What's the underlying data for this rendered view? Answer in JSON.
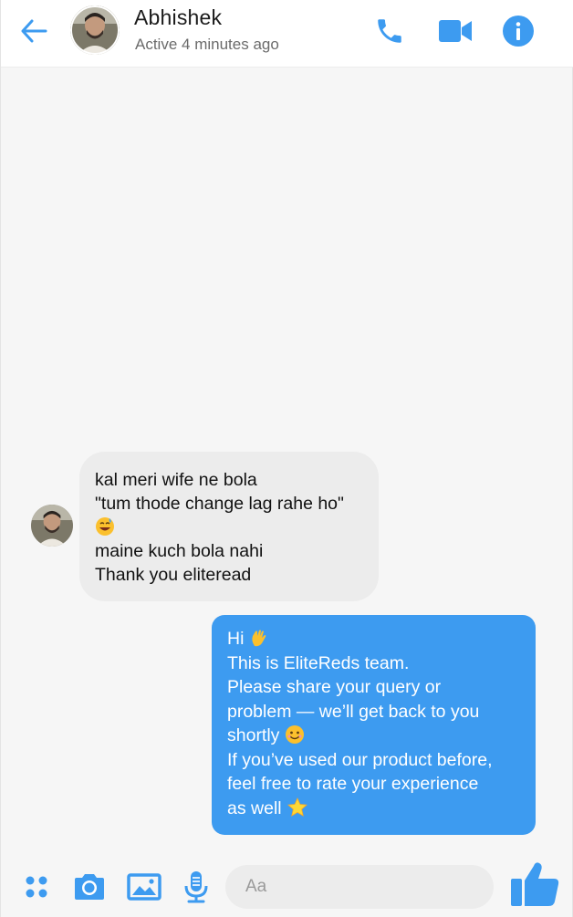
{
  "header": {
    "contact_name": "Abhishek",
    "status": "Active 4 minutes ago"
  },
  "messages": {
    "incoming": {
      "lines": [
        "kal meri wife ne bola",
        "\"tum thode change lag rahe ho\"",
        "",
        "maine kuch bola nahi",
        "Thank you eliteread"
      ],
      "emoji": "grinning-sweat-emoji"
    },
    "outgoing": {
      "lines": [
        "Hi",
        "This is EliteReds team.",
        "Please share your query or",
        "problem — we’ll get back to you",
        "shortly",
        "If you’ve used our product before,",
        "feel free to rate your experience",
        "as well"
      ],
      "emojis": [
        "waving-hand-emoji",
        "smiling-face-emoji",
        "star-emoji"
      ]
    }
  },
  "composer": {
    "placeholder": "Aa"
  },
  "icons": {
    "back": "arrow-left-icon",
    "phone": "phone-icon",
    "video": "video-camera-icon",
    "info": "info-icon",
    "apps": "four-dots-icon",
    "camera": "camera-icon",
    "gallery": "image-icon",
    "mic": "microphone-icon",
    "like": "thumbs-up-icon"
  },
  "colors": {
    "accent": "#3d9bf0",
    "incoming_bubble": "#ececec",
    "header_bg": "#ffffff"
  }
}
